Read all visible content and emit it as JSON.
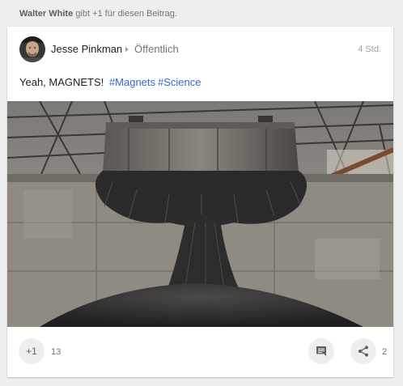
{
  "activity": {
    "name": "Walter White",
    "text": "gibt +1 für diesen Beitrag."
  },
  "post": {
    "author": "Jesse Pinkman",
    "visibility": "Öffentlich",
    "time": "4 Std.",
    "text": "Yeah, MAGNETS!",
    "hashtags": [
      "#Magnets",
      "#Science"
    ],
    "image": {
      "subject": "industrial lifting magnet with iron filings"
    }
  },
  "actions": {
    "plusone_label": "+1",
    "plusone_count": "13",
    "share_count": "2",
    "icons": {
      "comment": "comment-icon",
      "share": "share-icon"
    }
  },
  "colors": {
    "link": "#3367d6",
    "background": "#eeeeee",
    "card": "#ffffff"
  }
}
